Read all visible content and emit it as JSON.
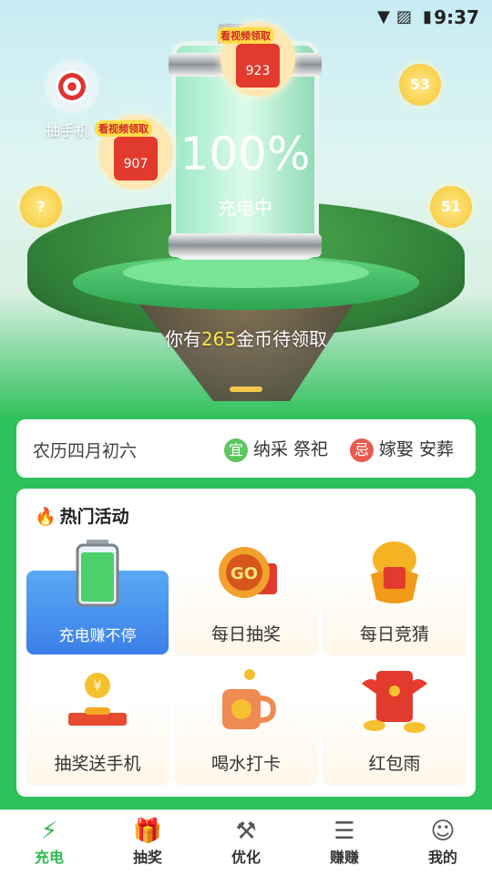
{
  "status_bar": {
    "time": "9:37"
  },
  "hero": {
    "target_label": "抽手机",
    "battery": {
      "percent_text": "100%",
      "state": "充电中",
      "level": 1.0
    },
    "envelopes": [
      {
        "tag": "看视频领取",
        "value": "923"
      },
      {
        "tag": "看视频领取",
        "value": "907"
      }
    ],
    "bubbles": [
      "53",
      "?",
      "51"
    ],
    "pending": {
      "prefix": "你有",
      "amount": "265",
      "suffix": "金币待领取"
    }
  },
  "almanac": {
    "lunar_date": "农历四月初六",
    "good": {
      "badge": "宜",
      "text": "纳采 祭祀",
      "color": "#5cc65f"
    },
    "bad": {
      "badge": "忌",
      "text": "嫁娶 安葬",
      "color": "#e85a4f"
    }
  },
  "activities": {
    "title": "热门活动",
    "items": [
      {
        "label": "充电赚不停",
        "icon": "battery-icon",
        "highlight": true
      },
      {
        "label": "每日抽奖",
        "icon": "lucky-coin-icon"
      },
      {
        "label": "每日竞猜",
        "icon": "golden-egg-icon"
      },
      {
        "label": "抽奖送手机",
        "icon": "coin-slot-icon"
      },
      {
        "label": "喝水打卡",
        "icon": "mug-icon"
      },
      {
        "label": "红包雨",
        "icon": "red-envelope-icon"
      }
    ]
  },
  "tabbar": {
    "tabs": [
      {
        "label": "充电",
        "icon": "charge-icon",
        "active": true
      },
      {
        "label": "抽奖",
        "icon": "gift-icon"
      },
      {
        "label": "优化",
        "icon": "tools-icon"
      },
      {
        "label": "赚赚",
        "icon": "coins-icon"
      },
      {
        "label": "我的",
        "icon": "smile-icon"
      }
    ]
  },
  "colors": {
    "accent": "#2db94f",
    "coin": "#ffe24a"
  }
}
